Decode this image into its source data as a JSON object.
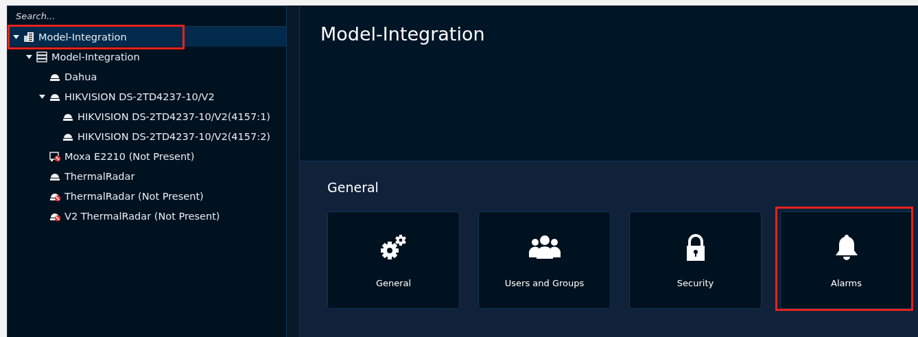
{
  "search": {
    "placeholder": "Search..."
  },
  "tree": [
    {
      "label": "Model-Integration",
      "kind": "building",
      "expanded": true,
      "selected": true,
      "highlighted": true,
      "children": [
        {
          "label": "Model-Integration",
          "kind": "rack",
          "expanded": true,
          "selected": false,
          "highlighted": false,
          "children": [
            {
              "label": "Dahua",
              "kind": "camera",
              "selected": false,
              "highlighted": false
            },
            {
              "label": "HIKVISION DS-2TD4237-10/V2",
              "kind": "camera",
              "expanded": true,
              "selected": false,
              "highlighted": false,
              "children": [
                {
                  "label": "HIKVISION DS-2TD4237-10/V2(4157:1)",
                  "kind": "camera",
                  "selected": false,
                  "highlighted": false
                },
                {
                  "label": "HIKVISION DS-2TD4237-10/V2(4157:2)",
                  "kind": "camera",
                  "selected": false,
                  "highlighted": false
                }
              ]
            },
            {
              "label": "Moxa E2210 (Not Present)",
              "kind": "io_offline",
              "selected": false,
              "highlighted": false
            },
            {
              "label": "ThermalRadar",
              "kind": "camera",
              "selected": false,
              "highlighted": false
            },
            {
              "label": "ThermalRadar (Not Present)",
              "kind": "camera_offline",
              "selected": false,
              "highlighted": false
            },
            {
              "label": "V2 ThermalRadar (Not Present)",
              "kind": "camera_offline",
              "selected": false,
              "highlighted": false
            }
          ]
        }
      ]
    }
  ],
  "header": {
    "title": "Model-Integration"
  },
  "section": {
    "title": "General",
    "cards": [
      {
        "label": "General",
        "kind": "gears",
        "highlighted": false
      },
      {
        "label": "Users and Groups",
        "kind": "users",
        "highlighted": false
      },
      {
        "label": "Security",
        "kind": "lock",
        "highlighted": false
      },
      {
        "label": "Alarms",
        "kind": "bell",
        "highlighted": true
      }
    ]
  }
}
